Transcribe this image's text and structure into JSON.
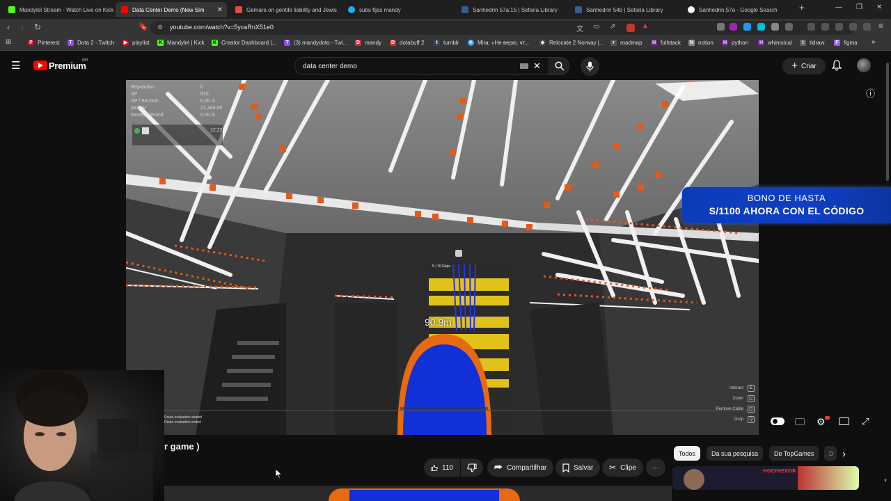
{
  "browser": {
    "tabs": [
      {
        "title": "Mandylel Stream - Watch Live on Kick",
        "color": "#53fc18",
        "active": false
      },
      {
        "title": "Data Center Demo (New Sim",
        "color": "#ff0000",
        "active": true
      },
      {
        "title": "Gemara on gentile liability and Jewis",
        "color": "#e84a3c",
        "active": false
      },
      {
        "title": "subs fijas mandy",
        "color": "#2aabee",
        "active": false
      },
      {
        "title": "Sanhedrin 57a:15 | Sefaria Library",
        "color": "#3b5998",
        "active": false
      },
      {
        "title": "Sanhedrin 54b | Sefaria Library",
        "color": "#3b5998",
        "active": false
      },
      {
        "title": "Sanhedrin.57a - Google Search",
        "color": "#ffffff",
        "active": false
      }
    ],
    "new_tab_symbol": "+",
    "url": "youtube.com/watch?v=5ycaRnX51e0",
    "bookmarks": [
      {
        "label": "Pinterest",
        "color": "#e60023",
        "glyph": "P"
      },
      {
        "label": "Dota 2 - Twitch",
        "color": "#9146ff",
        "glyph": "T"
      },
      {
        "label": "playlist",
        "color": "#ff0000",
        "glyph": "▶"
      },
      {
        "label": "Mandylel | Kick",
        "color": "#53fc18",
        "glyph": "K"
      },
      {
        "label": "Creator Dashboard |...",
        "color": "#53fc18",
        "glyph": "K"
      },
      {
        "label": "(3) mandydoto - Twi...",
        "color": "#9146ff",
        "glyph": "T"
      },
      {
        "label": "mandy",
        "color": "#d32f2f",
        "glyph": "D"
      },
      {
        "label": "dotabuff 2",
        "color": "#d32f2f",
        "glyph": "D"
      },
      {
        "label": "tumblr",
        "color": "#36465d",
        "glyph": "t"
      },
      {
        "label": "Mira: «Не верю, чт...",
        "color": "#2aabee",
        "glyph": "✈"
      },
      {
        "label": "Relocate 2 Norway |...",
        "color": "#444",
        "glyph": "◆"
      },
      {
        "label": "roadmap",
        "color": "#555",
        "glyph": "r"
      },
      {
        "label": "fullstack",
        "color": "#7b1fa2",
        "glyph": "H"
      },
      {
        "label": "notion",
        "color": "#888",
        "glyph": "N"
      },
      {
        "label": "python",
        "color": "#7b1fa2",
        "glyph": "H"
      },
      {
        "label": "whimsical",
        "color": "#7b1fa2",
        "glyph": "H"
      },
      {
        "label": "tldraw",
        "color": "#666",
        "glyph": "t"
      },
      {
        "label": "figma",
        "color": "#a259ff",
        "glyph": "F"
      }
    ]
  },
  "youtube": {
    "logo_text": "Premium",
    "region": "BR",
    "search_value": "data center demo",
    "create_label": "Criar",
    "promo": {
      "line1": "BONO DE HASTA",
      "line2": "S/1100 AHORA CON EL CÓDIGO"
    },
    "video": {
      "distance_label": "90.9m",
      "rack_label": "5 / 10 Gbps",
      "hud": [
        {
          "label": "Reputation",
          "value": "0"
        },
        {
          "label": "XP",
          "value": "610"
        },
        {
          "label": "XP / Second",
          "value": "0.00 /s"
        },
        {
          "label": "Money",
          "value": "21,344.00"
        },
        {
          "label": "Money/Second",
          "value": "0.00 /s"
        }
      ],
      "time": "12:22",
      "key_hints": [
        {
          "label": "Interact",
          "key": "E"
        },
        {
          "label": "Zoom",
          "key": "◫"
        },
        {
          "label": "Remove Cable",
          "key": "◫"
        },
        {
          "label": "Drop",
          "key": "Q"
        }
      ],
      "log_lines": [
        "Route evaluation started",
        "Route evaluation ended"
      ]
    },
    "title_fragment": "r game )",
    "actions": {
      "like_count": "110",
      "share_label": "Compartilhar",
      "save_label": "Salvar",
      "clip_label": "Clipe",
      "more_label": "···"
    },
    "chips": [
      {
        "label": "Todos",
        "active": true
      },
      {
        "label": "Da sua pesquisa",
        "active": false
      },
      {
        "label": "De TopGames",
        "active": false
      },
      {
        "label": "D",
        "active": false
      }
    ],
    "thumb_text": "HOLYHEXOR"
  }
}
